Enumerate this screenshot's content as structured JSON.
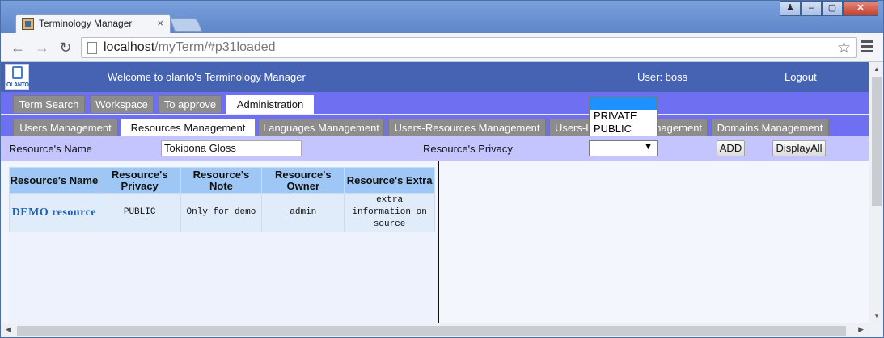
{
  "browser": {
    "tab_title": "Terminology Manager",
    "tab_close": "×",
    "url_host": "localhost",
    "url_path": "/myTerm/#p31loaded",
    "win_buttons": [
      "♟",
      "–",
      "▢",
      "✕"
    ]
  },
  "app": {
    "logo_text": "OLANTO",
    "welcome": "Welcome to olanto's Terminology Manager",
    "user": "User: boss",
    "logout": "Logout"
  },
  "main_tabs": [
    {
      "label": "Term Search"
    },
    {
      "label": "Workspace"
    },
    {
      "label": "To approve"
    },
    {
      "label": "Administration",
      "active": true
    }
  ],
  "sub_tabs": [
    {
      "label": "Users Management"
    },
    {
      "label": "Resources Management",
      "active": true
    },
    {
      "label": "Languages Management"
    },
    {
      "label": "Users-Resources Management"
    },
    {
      "label": "Users-Languages Management"
    },
    {
      "label": "Domains Management"
    }
  ],
  "form": {
    "name_label": "Resource's Name",
    "name_value": "Tokipona Gloss",
    "privacy_label": "Resource's Privacy",
    "privacy_value": "",
    "privacy_options": [
      "",
      "PRIVATE",
      "PUBLIC"
    ],
    "add_label": "ADD",
    "display_all_label": "DisplayAll"
  },
  "table": {
    "headers": [
      "Resource's Name",
      "Resource's Privacy",
      "Resource's Note",
      "Resource's Owner",
      "Resource's Extra"
    ],
    "rows": [
      [
        "DEMO resource",
        "PUBLIC",
        "Only for demo",
        "admin",
        "extra information on source"
      ]
    ]
  }
}
